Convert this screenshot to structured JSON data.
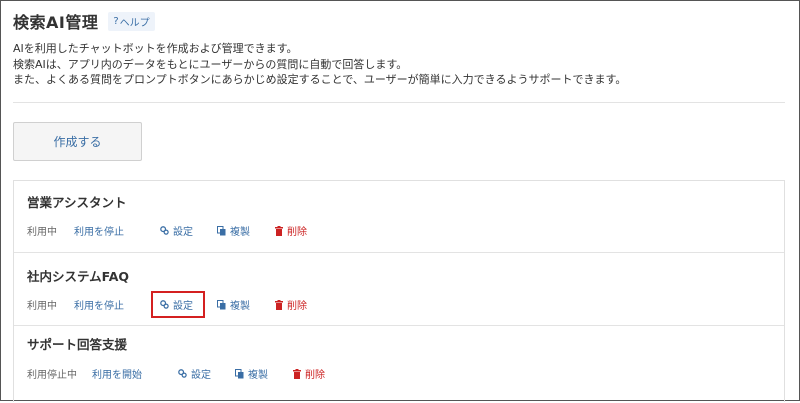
{
  "header": {
    "title": "検索AI管理",
    "help_label": "ヘルプ",
    "help_icon": "?"
  },
  "description": [
    "AIを利用したチャットボットを作成および管理できます。",
    "検索AIは、アプリ内のデータをもとにユーザーからの質問に自動で回答します。",
    "また、よくある質問をプロンプトボタンにあらかじめ設定することで、ユーザーが簡単に入力できるようサポートできます。"
  ],
  "create_button": "作成する",
  "items": [
    {
      "name": "営業アシスタント",
      "status": "利用中",
      "toggle": "利用を停止",
      "settings": "設定",
      "duplicate": "複製",
      "delete": "削除"
    },
    {
      "name": "社内システムFAQ",
      "status": "利用中",
      "toggle": "利用を停止",
      "settings": "設定",
      "duplicate": "複製",
      "delete": "削除"
    },
    {
      "name": "サポート回答支援",
      "status": "利用停止中",
      "toggle": "利用を開始",
      "settings": "設定",
      "duplicate": "複製",
      "delete": "削除"
    }
  ],
  "colors": {
    "link": "#3a6ea5",
    "delete": "#cc2222",
    "highlight": "#d42020"
  },
  "icons": {
    "settings": "gear-icon",
    "duplicate": "duplicate-icon",
    "delete": "trash-icon"
  }
}
